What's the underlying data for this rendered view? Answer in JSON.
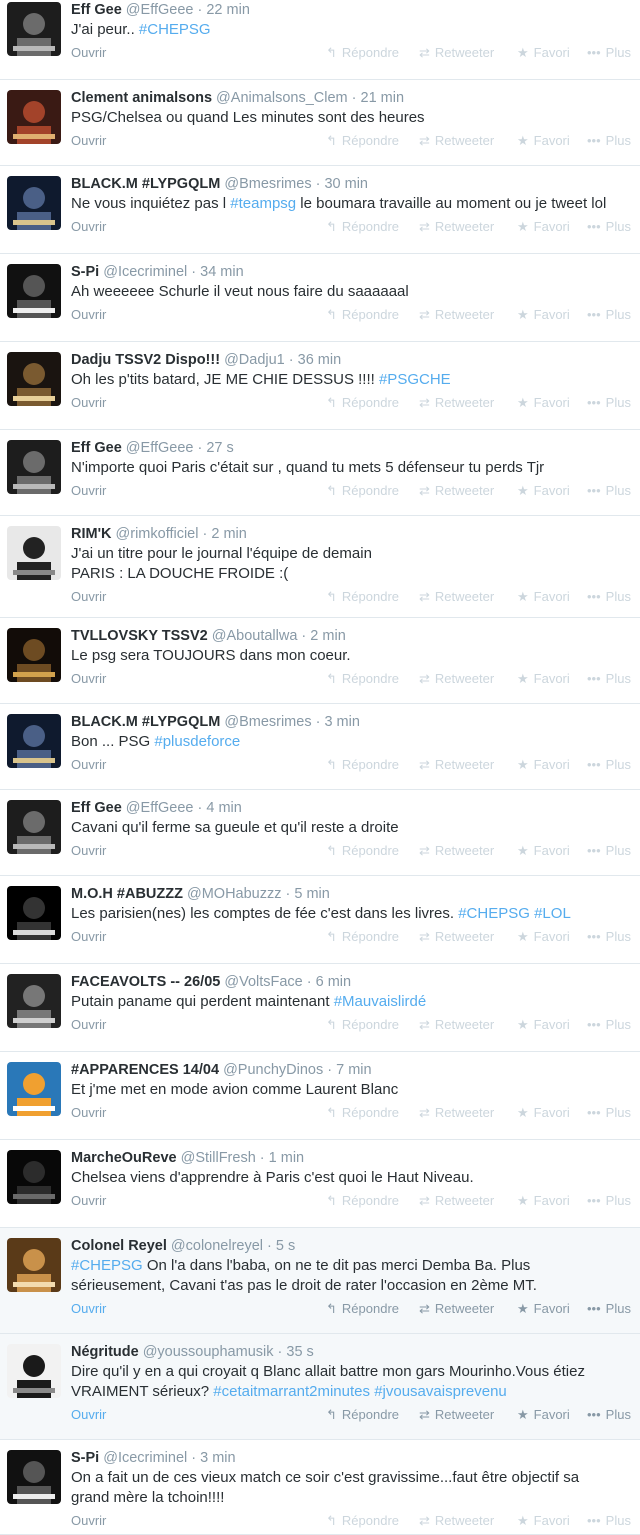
{
  "actions": {
    "open": "Ouvrir",
    "reply": "Répondre",
    "retweet": "Retweeter",
    "favorite": "Favori",
    "more": "Plus"
  },
  "icons": {
    "reply": "reply-arrow-icon",
    "retweet": "retweet-icon",
    "favorite": "star-icon",
    "more": "dots-icon"
  },
  "colors": {
    "link": "#55acee",
    "muted": "#8899a6",
    "faint": "#ccd6dd",
    "highlight_bg": "#f5f8fa"
  },
  "tweets": [
    {
      "name": "Eff Gee",
      "handle": "@EffGeee",
      "time": "22 min",
      "text": [
        {
          "t": "J'ai peur.. "
        },
        {
          "t": "#CHEPSG",
          "tag": true
        }
      ]
    },
    {
      "name": "Clement animalsons",
      "handle": "@Animalsons_Clem",
      "time": "21 min",
      "text": [
        {
          "t": "PSG/Chelsea ou quand Les minutes sont des heures"
        }
      ]
    },
    {
      "name": "BLACK.M #LYPGQLM",
      "handle": "@Bmesrimes",
      "time": "30 min",
      "text": [
        {
          "t": "Ne vous inquiétez pas l "
        },
        {
          "t": "#teampsg",
          "tag": true
        },
        {
          "t": " le boumara travaille au moment ou je tweet lol"
        }
      ]
    },
    {
      "name": "S-Pi",
      "handle": "@Icecriminel",
      "time": "34 min",
      "text": [
        {
          "t": "Ah weeeeee Schurle il veut nous faire du saaaaaal"
        }
      ]
    },
    {
      "name": "Dadju TSSV2 Dispo!!!",
      "handle": "@Dadju1",
      "time": "36 min",
      "text": [
        {
          "t": "Oh les p'tits batard, JE ME CHIE DESSUS !!!! "
        },
        {
          "t": "#PSGCHE",
          "tag": true
        }
      ]
    },
    {
      "name": "Eff Gee",
      "handle": "@EffGeee",
      "time": "27 s",
      "text": [
        {
          "t": "N'importe quoi Paris c'était sur , quand tu mets  5 défenseur tu perds Tjr"
        }
      ]
    },
    {
      "name": "RIM'K",
      "handle": "@rimkofficiel",
      "time": "2 min",
      "text": [
        {
          "t": "J'ai un titre pour le journal l'équipe de demain"
        },
        {
          "br": true
        },
        {
          "t": "PARIS : LA DOUCHE FROIDE :("
        }
      ]
    },
    {
      "name": "TVLLOVSKY TSSV2",
      "handle": "@Aboutallwa",
      "time": "2 min",
      "text": [
        {
          "t": "Le psg sera TOUJOURS dans mon coeur."
        }
      ]
    },
    {
      "name": "BLACK.M #LYPGQLM",
      "handle": "@Bmesrimes",
      "time": "3 min",
      "text": [
        {
          "t": "Bon ... PSG "
        },
        {
          "t": "#plusdeforce",
          "tag": true
        }
      ]
    },
    {
      "name": "Eff Gee",
      "handle": "@EffGeee",
      "time": "4 min",
      "text": [
        {
          "t": "Cavani qu'il ferme sa gueule et qu'il reste a droite"
        }
      ]
    },
    {
      "name": "M.O.H #ABUZZZ",
      "handle": "@MOHabuzzz",
      "time": "5 min",
      "text": [
        {
          "t": "Les parisien(nes) les comptes de fée c'est dans les livres. "
        },
        {
          "t": "#CHEPSG",
          "tag": true
        },
        {
          "t": " "
        },
        {
          "t": "#LOL",
          "tag": true
        }
      ]
    },
    {
      "name": "FACEAVOLTS -- 26/05",
      "handle": "@VoltsFace",
      "time": "6 min",
      "text": [
        {
          "t": "Putain paname qui perdent maintenant "
        },
        {
          "t": "#Mauvaislirdé",
          "tag": true
        }
      ]
    },
    {
      "name": "#APPARENCES 14/04",
      "handle": "@PunchyDinos",
      "time": "7 min",
      "text": [
        {
          "t": "Et j'me met en mode avion comme Laurent Blanc"
        }
      ]
    },
    {
      "name": "MarcheOuReve",
      "handle": "@StillFresh",
      "time": "1 min",
      "text": [
        {
          "t": "Chelsea viens d'apprendre à Paris c'est quoi le Haut Niveau."
        }
      ]
    },
    {
      "name": "Colonel Reyel",
      "handle": "@colonelreyel",
      "time": "5 s",
      "text": [
        {
          "t": "#CHEPSG",
          "tag": true
        },
        {
          "t": " On l'a dans l'baba, on ne te dit pas merci Demba Ba. Plus"
        },
        {
          "br": true
        },
        {
          "t": "sérieusement, Cavani t'as pas le droit de rater l'occasion en 2ème MT."
        }
      ]
    },
    {
      "name": "Négritude",
      "handle": "@youssouphamusik",
      "time": "35 s",
      "text": [
        {
          "t": "Dire qu'il y en a qui croyait q Blanc allait battre mon gars Mourinho.Vous étiez"
        },
        {
          "br": true
        },
        {
          "t": "VRAIMENT sérieux? "
        },
        {
          "t": "#cetaitmarrant2minutes",
          "tag": true
        },
        {
          "t": " "
        },
        {
          "t": "#jvousavaisprevenu",
          "tag": true
        }
      ]
    },
    {
      "name": "S-Pi",
      "handle": "@Icecriminel",
      "time": "3 min",
      "text": [
        {
          "t": "On a fait un de ces vieux match ce soir c'est gravissime...faut être objectif sa"
        },
        {
          "br": true
        },
        {
          "t": "grand mère la tchoin!!!!"
        }
      ]
    }
  ]
}
